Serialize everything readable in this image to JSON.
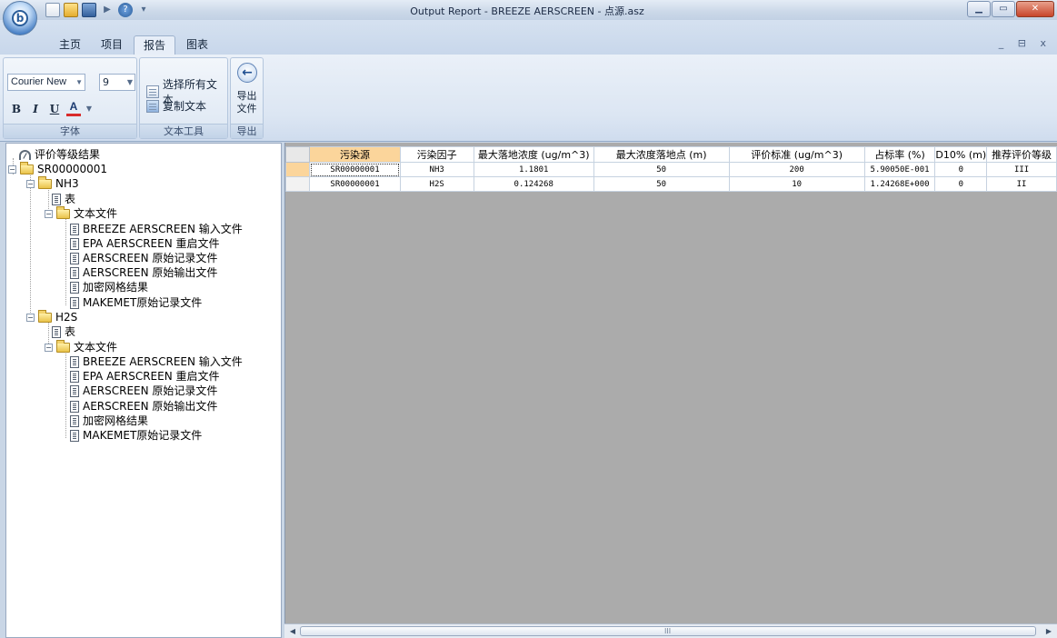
{
  "window": {
    "title": "Output Report - BREEZE AERSCREEN - 点源.asz",
    "mdi_controls": "_ ⊟ x"
  },
  "ribbon": {
    "tabs": [
      "主页",
      "项目",
      "报告",
      "图表"
    ],
    "active_tab": "报告",
    "font_group": {
      "label": "字体",
      "font_name": "Courier New",
      "font_size": "9",
      "bold": "B",
      "italic": "I",
      "underline": "U",
      "font_color": "A"
    },
    "text_tools_group": {
      "label": "文本工具",
      "select_all": "选择所有文本",
      "copy_text": "复制文本"
    },
    "export_group": {
      "label": "导出",
      "export_file": "导出\n文件"
    }
  },
  "tree": {
    "root": "评价等级结果",
    "source": "SR00000001",
    "pollutants": [
      {
        "name": "NH3",
        "table": "表",
        "text_folder": "文本文件",
        "files": [
          "BREEZE AERSCREEN 输入文件",
          "EPA AERSCREEN 重启文件",
          "AERSCREEN 原始记录文件",
          "AERSCREEN 原始输出文件",
          "加密网格结果",
          "MAKEMET原始记录文件"
        ]
      },
      {
        "name": "H2S",
        "table": "表",
        "text_folder": "文本文件",
        "files": [
          "BREEZE AERSCREEN 输入文件",
          "EPA AERSCREEN 重启文件",
          "AERSCREEN 原始记录文件",
          "AERSCREEN 原始输出文件",
          "加密网格结果",
          "MAKEMET原始记录文件"
        ]
      }
    ]
  },
  "grid": {
    "columns": [
      "污染源",
      "污染因子",
      "最大落地浓度 (ug/m^3)",
      "最大浓度落地点 (m)",
      "评价标准 (ug/m^3)",
      "占标率 (%)",
      "D10% (m)",
      "推荐评价等级"
    ],
    "rows": [
      [
        "SR00000001",
        "NH3",
        "1.1801",
        "50",
        "200",
        "5.90050E-001",
        "0",
        "III"
      ],
      [
        "SR00000001",
        "H2S",
        "0.124268",
        "50",
        "10",
        "1.24268E+000",
        "0",
        "II"
      ]
    ]
  },
  "scrollbar": {
    "grip": "III"
  }
}
